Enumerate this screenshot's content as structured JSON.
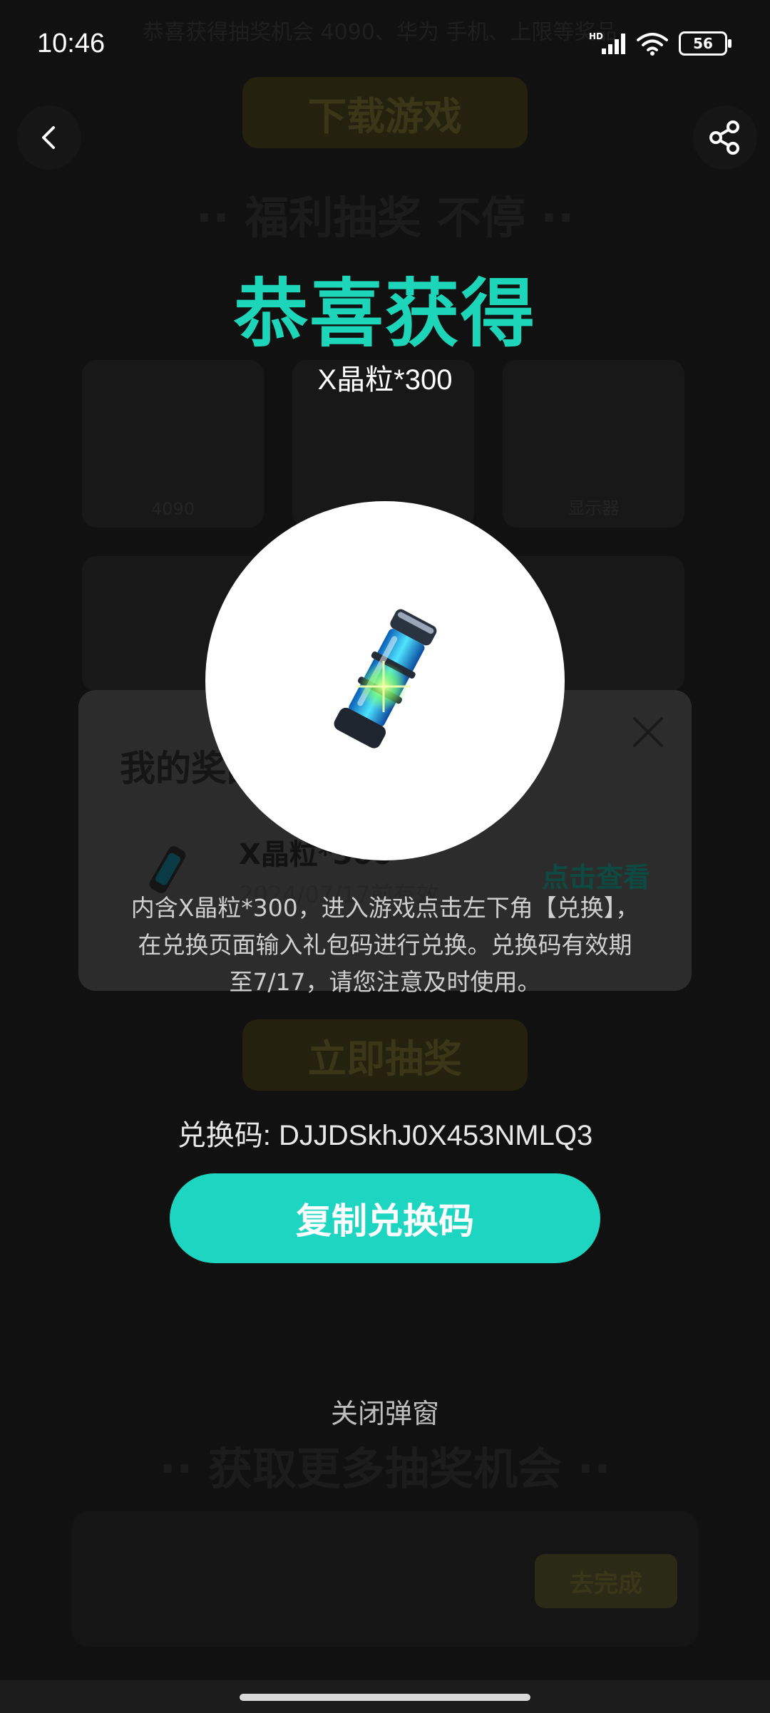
{
  "status_bar": {
    "time": "10:46",
    "battery": "56",
    "network_label": "HD"
  },
  "background": {
    "marquee": "恭喜获得抽奖机会 4090、华为 手机、上限等奖品",
    "top_button": "下载游戏",
    "prize_heading": "·· 福利抽奖 不停 ··",
    "lottery_button": "立即抽奖",
    "more_heading": "·· 获取更多抽奖机会 ··",
    "task_button": "去完成",
    "card_labels": [
      "4090",
      "",
      "显示器"
    ]
  },
  "prize_panel": {
    "title": "我的奖品",
    "item_name": "X晶粒*300",
    "item_date": "2024/07/17前有效",
    "view_link": "点击查看"
  },
  "modal": {
    "title": "恭喜获得",
    "subtitle": "X晶粒*300",
    "description": "内含X晶粒*300，进入游戏点击左下角【兑换】，在兑换页面输入礼包码进行兑换。兑换码有效期至7/17，请您注意及时使用。",
    "code_label": "兑换码: DJJDSkhJ0X453NMLQ3",
    "copy_button": "复制兑换码",
    "close_link": "关闭弹窗"
  },
  "icons": {
    "back": "chevron-left-icon",
    "share": "share-icon",
    "item": "crystal-capsule-icon"
  },
  "colors": {
    "accent": "#1dd5b8",
    "button": "#1dd5c0"
  }
}
